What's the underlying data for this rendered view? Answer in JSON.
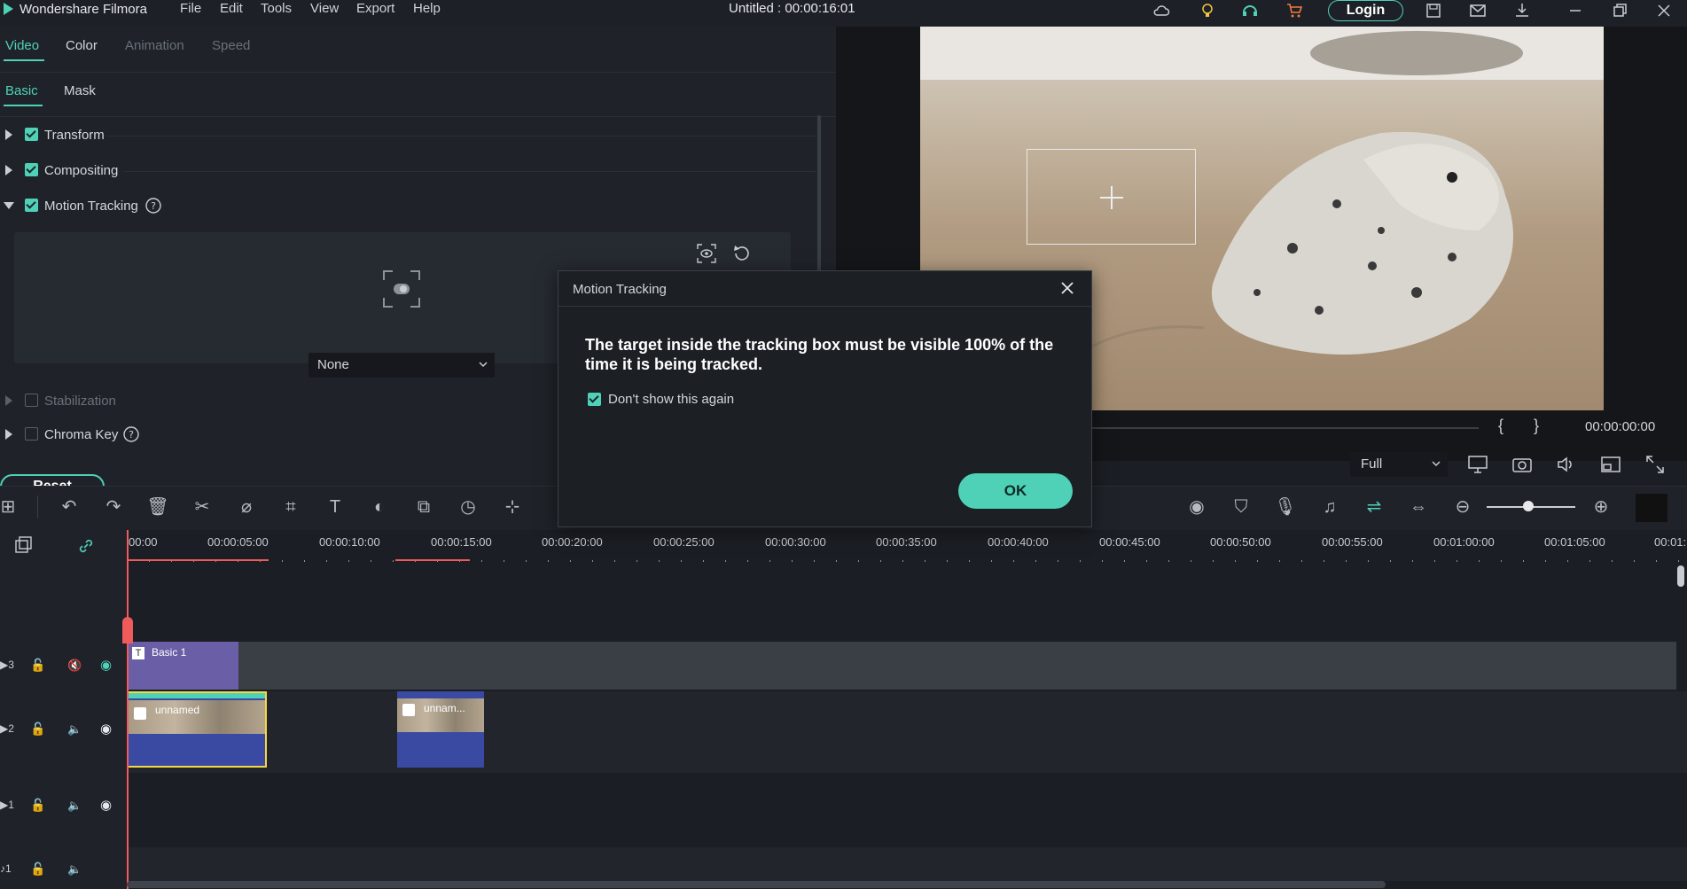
{
  "app": {
    "name": "Wondershare Filmora",
    "window_title": "Untitled : 00:00:16:01",
    "menu": [
      "File",
      "Edit",
      "Tools",
      "View",
      "Export",
      "Help"
    ],
    "login_label": "Login"
  },
  "left_panel": {
    "tabs": [
      "Video",
      "Color",
      "Animation",
      "Speed"
    ],
    "subtabs": [
      "Basic",
      "Mask"
    ],
    "sections": {
      "transform": "Transform",
      "compositing": "Compositing",
      "motion_tracking": "Motion Tracking",
      "stabilization": "Stabilization",
      "chroma_key": "Chroma Key"
    },
    "tracking_select": "None",
    "reset_label": "Reset"
  },
  "preview": {
    "timecode": "00:00:00:00",
    "quality": "Full",
    "bracket_in": "{",
    "bracket_out": "}"
  },
  "timeline": {
    "ruler": [
      "00:00",
      "00:00:05:00",
      "00:00:10:00",
      "00:00:15:00",
      "00:00:20:00",
      "00:00:25:00",
      "00:00:30:00",
      "00:00:35:00",
      "00:00:40:00",
      "00:00:45:00",
      "00:00:50:00",
      "00:00:55:00",
      "00:01:00:00",
      "00:01:05:00",
      "00:01:"
    ],
    "tracks": {
      "t3": "3",
      "t2": "2",
      "t1": "1",
      "a1": "1"
    },
    "clips": {
      "title_clip": "Basic 1",
      "video_clip_1": "unnamed",
      "video_clip_2": "unnam..."
    }
  },
  "dialog": {
    "title": "Motion Tracking",
    "message": "The target inside the tracking box must be visible 100% of the time it is being tracked.",
    "checkbox_label": "Don't show this again",
    "checkbox_checked": true,
    "ok_label": "OK"
  },
  "colors": {
    "accent": "#4fd1b8",
    "playhead": "#ef5b5b",
    "title_clip": "#6a5fa6",
    "video_clip": "#3a4aa2"
  }
}
